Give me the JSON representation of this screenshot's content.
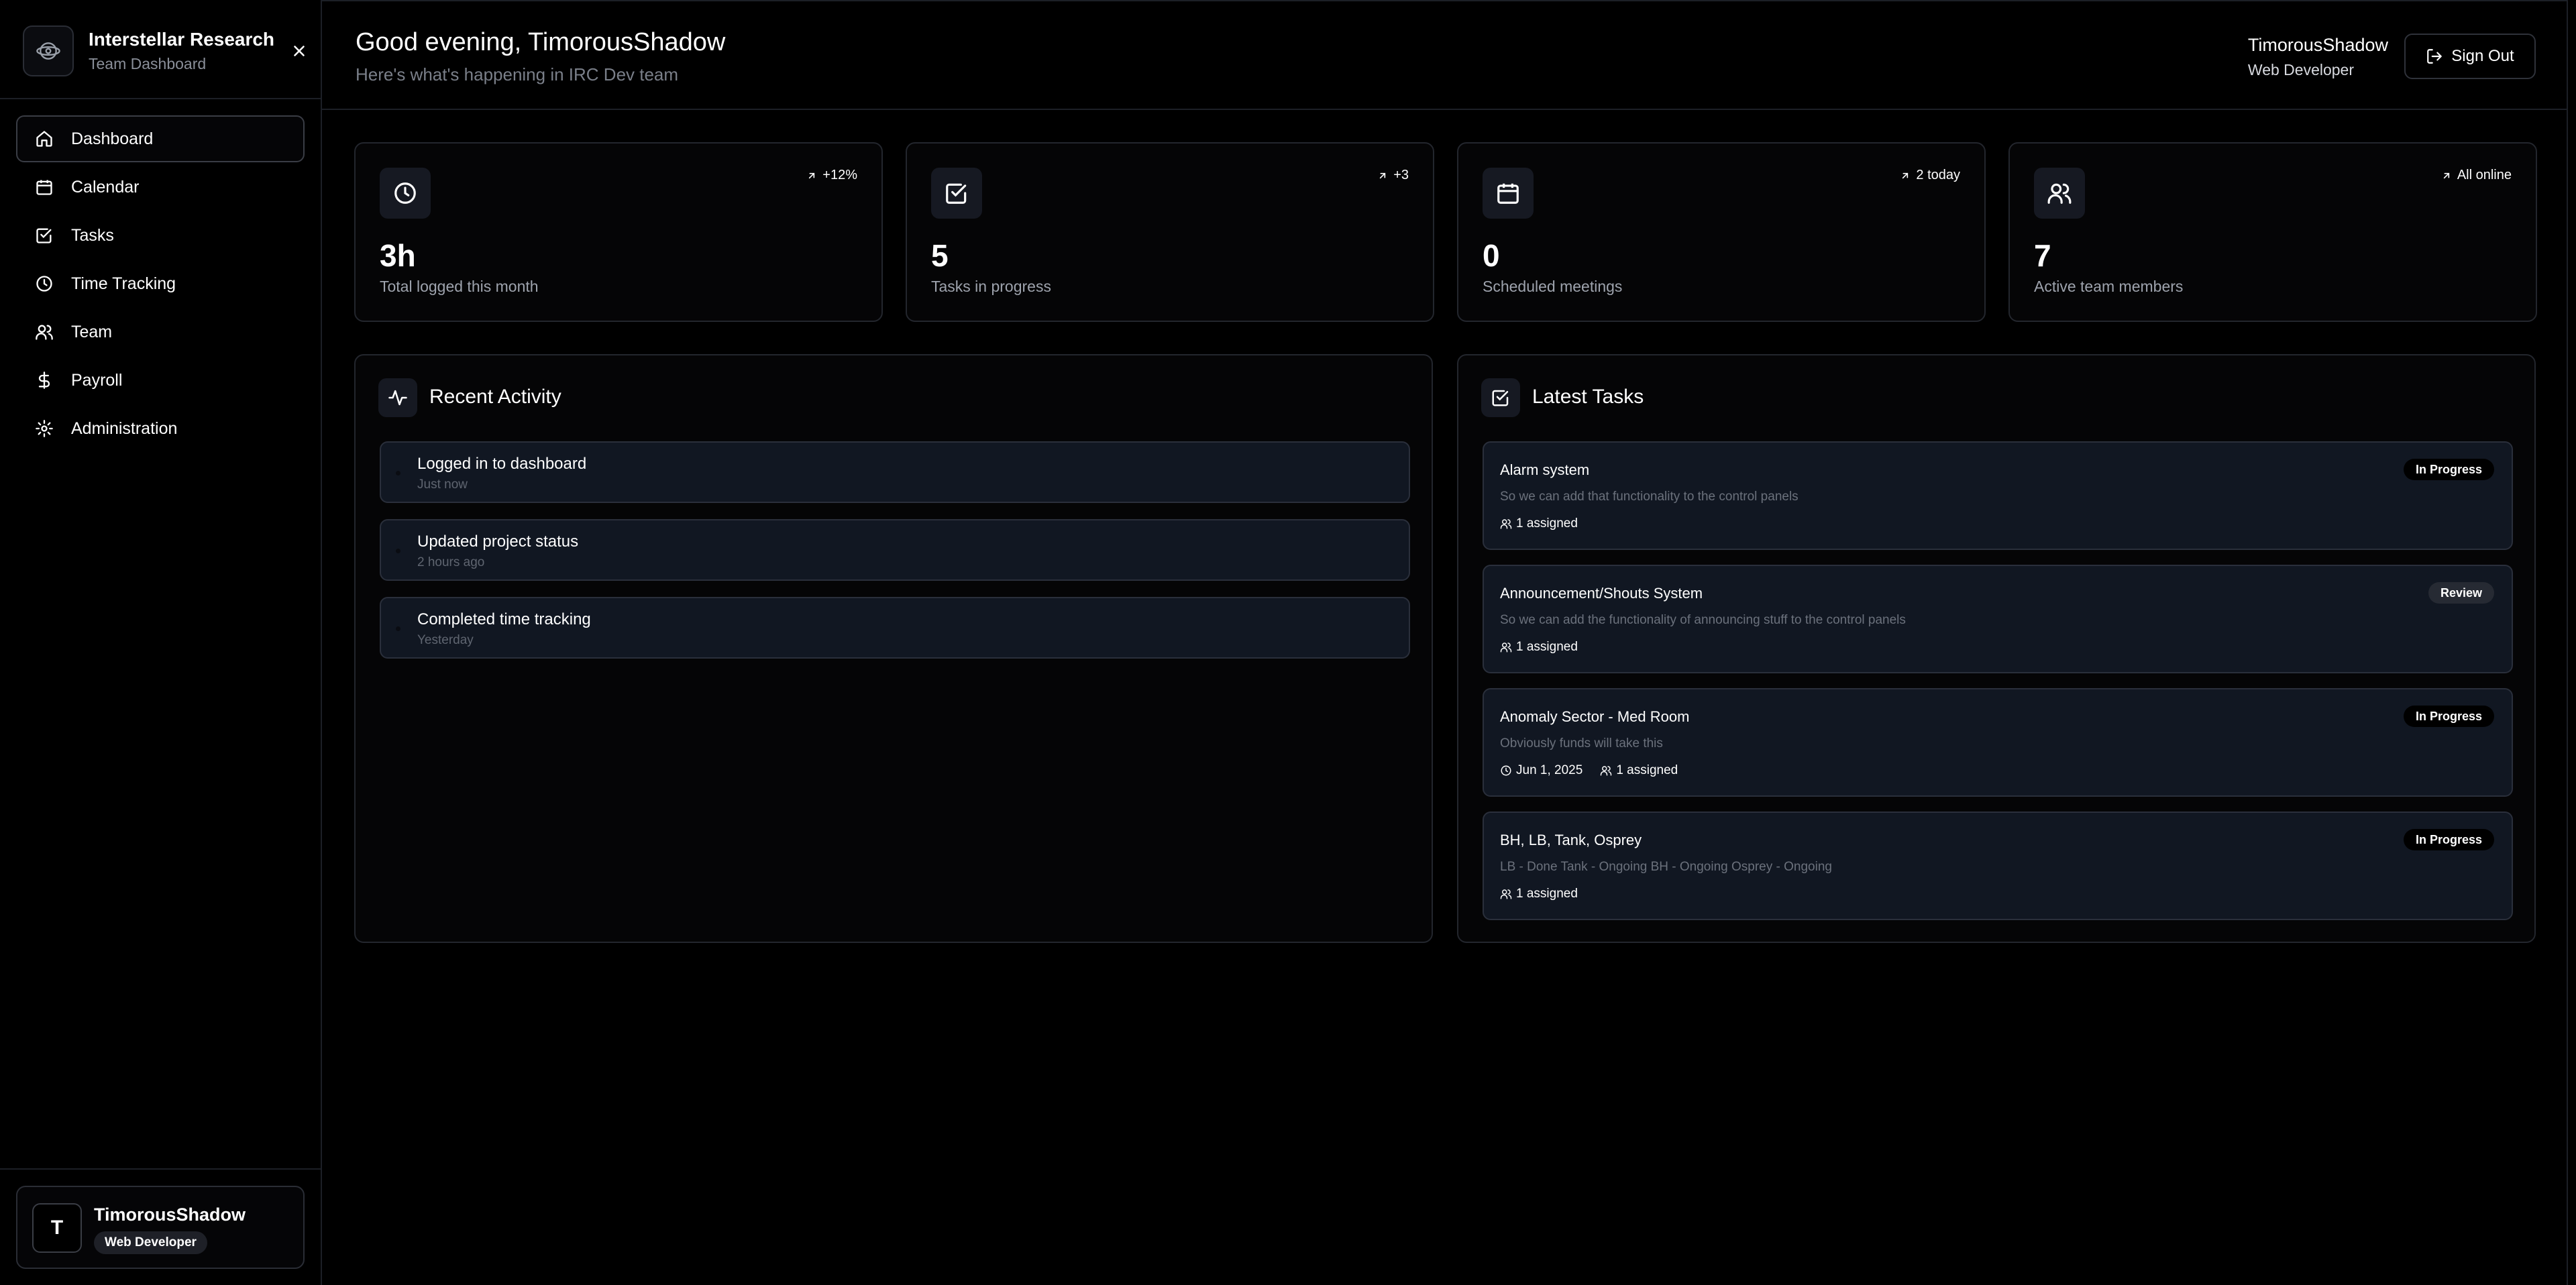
{
  "sidebar": {
    "brand_title": "Interstellar Research",
    "brand_subtitle": "Team Dashboard",
    "nav": [
      {
        "label": "Dashboard",
        "icon": "home-icon"
      },
      {
        "label": "Calendar",
        "icon": "calendar-icon"
      },
      {
        "label": "Tasks",
        "icon": "checkbox-icon"
      },
      {
        "label": "Time Tracking",
        "icon": "clock-icon"
      },
      {
        "label": "Team",
        "icon": "users-icon"
      },
      {
        "label": "Payroll",
        "icon": "dollar-icon"
      },
      {
        "label": "Administration",
        "icon": "gear-icon"
      }
    ],
    "active_item": "Dashboard",
    "user": {
      "initial": "T",
      "name": "TimorousShadow",
      "role": "Web Developer"
    }
  },
  "header": {
    "greeting": "Good evening, TimorousShadow",
    "subtitle": "Here's what's happening in IRC Dev team",
    "user_name": "TimorousShadow",
    "user_role": "Web Developer",
    "signout_label": "Sign Out"
  },
  "stats": [
    {
      "value": "3h",
      "label": "Total logged this month",
      "trend": "+12%",
      "icon": "clock-icon"
    },
    {
      "value": "5",
      "label": "Tasks in progress",
      "trend": "+3",
      "icon": "checkbox-icon"
    },
    {
      "value": "0",
      "label": "Scheduled meetings",
      "trend": "2 today",
      "icon": "calendar-icon"
    },
    {
      "value": "7",
      "label": "Active team members",
      "trend": "All online",
      "icon": "users-icon"
    }
  ],
  "recent_activity": {
    "title": "Recent Activity",
    "items": [
      {
        "title": "Logged in to dashboard",
        "time": "Just now"
      },
      {
        "title": "Updated project status",
        "time": "2 hours ago"
      },
      {
        "title": "Completed time tracking",
        "time": "Yesterday"
      }
    ]
  },
  "latest_tasks": {
    "title": "Latest Tasks",
    "items": [
      {
        "title": "Alarm system",
        "description": "So we can add that functionality to the control panels",
        "due": "",
        "assigned": "1 assigned",
        "status": "In Progress"
      },
      {
        "title": "Announcement/Shouts System",
        "description": "So we can add the functionality of announcing stuff to the control panels",
        "due": "",
        "assigned": "1 assigned",
        "status": "Review"
      },
      {
        "title": "Anomaly Sector - Med Room",
        "description": "Obviously funds will take this",
        "due": "Jun 1, 2025",
        "assigned": "1 assigned",
        "status": "In Progress"
      },
      {
        "title": "BH, LB, Tank, Osprey",
        "description": "LB - Done Tank - Ongoing BH - Ongoing Osprey - Ongoing",
        "due": "",
        "assigned": "1 assigned",
        "status": "In Progress"
      }
    ]
  },
  "colors": {
    "background": "#000000",
    "card": "#050506",
    "row": "#111722",
    "border": "#23262d",
    "muted_text": "#7a7f89"
  }
}
